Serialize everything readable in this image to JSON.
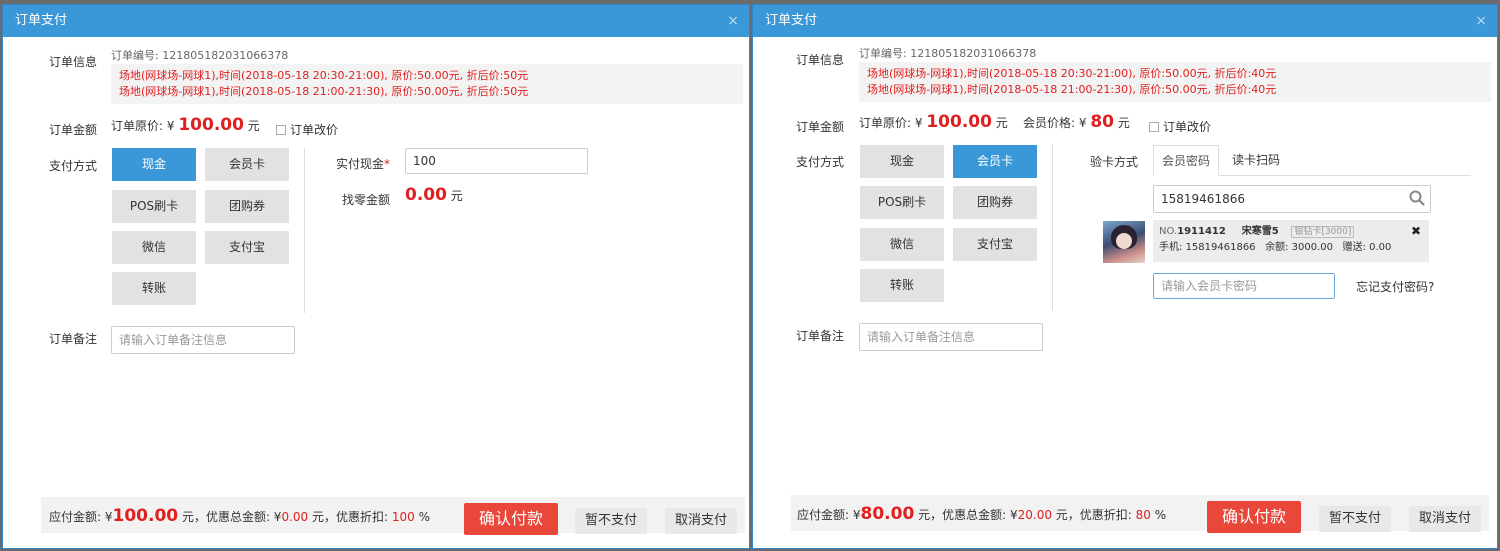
{
  "left": {
    "title": "订单支付",
    "close": "×",
    "order_info_label": "订单信息",
    "order_no_label": "订单编号:",
    "order_no": "121805182031066378",
    "order_lines": [
      "场地(网球场-网球1),时间(2018-05-18 20:30-21:00), 原价:50.00元, 折后价:50元",
      "场地(网球场-网球1),时间(2018-05-18 21:00-21:30), 原价:50.00元, 折后价:50元"
    ],
    "amount_label": "订单金额",
    "original_price_label": "订单原价: ¥",
    "original_price": "100.00",
    "yuan": "元",
    "modify_price_label": "订单改价",
    "pay_method_label": "支付方式",
    "pay_methods": [
      "现金",
      "会员卡",
      "POS刷卡",
      "团购券",
      "微信",
      "支付宝",
      "转账"
    ],
    "active_method": "现金",
    "cash_label": "实付现金",
    "required_mark": "*",
    "cash_value": "100",
    "change_label": "找零金额",
    "change_value": "0.00",
    "change_unit": "元",
    "remark_label": "订单备注",
    "remark_placeholder": "请输入订单备注信息",
    "footer": {
      "payable_label": "应付金额: ¥",
      "payable": "100.00",
      "discount_total_label": "元，优惠总金额: ¥",
      "discount_total": "0.00",
      "discount_rate_label": "元，优惠折扣:",
      "discount_rate": "100",
      "percent": "%",
      "confirm": "确认付款",
      "defer": "暂不支付",
      "cancel": "取消支付"
    }
  },
  "right": {
    "title": "订单支付",
    "close": "×",
    "order_info_label": "订单信息",
    "order_no_label": "订单编号:",
    "order_no": "121805182031066378",
    "order_lines": [
      "场地(网球场-网球1),时间(2018-05-18 20:30-21:00), 原价:50.00元, 折后价:40元",
      "场地(网球场-网球1),时间(2018-05-18 21:00-21:30), 原价:50.00元, 折后价:40元"
    ],
    "amount_label": "订单金额",
    "original_price_label": "订单原价: ¥",
    "original_price": "100.00",
    "yuan": "元",
    "member_price_label": "会员价格: ¥",
    "member_price": "80",
    "modify_price_label": "订单改价",
    "pay_method_label": "支付方式",
    "pay_methods": [
      "现金",
      "会员卡",
      "POS刷卡",
      "团购券",
      "微信",
      "支付宝",
      "转账"
    ],
    "active_method": "会员卡",
    "verify_label": "验卡方式",
    "tabs": [
      "会员密码",
      "读卡扫码"
    ],
    "search_value": "15819461866",
    "member": {
      "no_label": "NO.",
      "no": "1911412",
      "name": "宋寒雪5",
      "card_type": "银钻卡[3000]",
      "phone_label": "手机:",
      "phone": "15819461866",
      "balance_label": "余额:",
      "balance": "3000.00",
      "gift_label": "赠送:",
      "gift": "0.00",
      "remove": "✖"
    },
    "password_placeholder": "请输入会员卡密码",
    "forgot_link": "忘记支付密码?",
    "remark_label": "订单备注",
    "remark_placeholder": "请输入订单备注信息",
    "footer": {
      "payable_label": "应付金额: ¥",
      "payable": "80.00",
      "discount_total_label": "元，优惠总金额: ¥",
      "discount_total": "20.00",
      "discount_rate_label": "元，优惠折扣:",
      "discount_rate": "80",
      "percent": "%",
      "confirm": "确认付款",
      "defer": "暂不支付",
      "cancel": "取消支付"
    }
  },
  "colors": {
    "title_bar": "#3a97d8",
    "active_button": "#3a97d8",
    "confirm_button": "#e8473a",
    "price_red": "#e02020"
  }
}
